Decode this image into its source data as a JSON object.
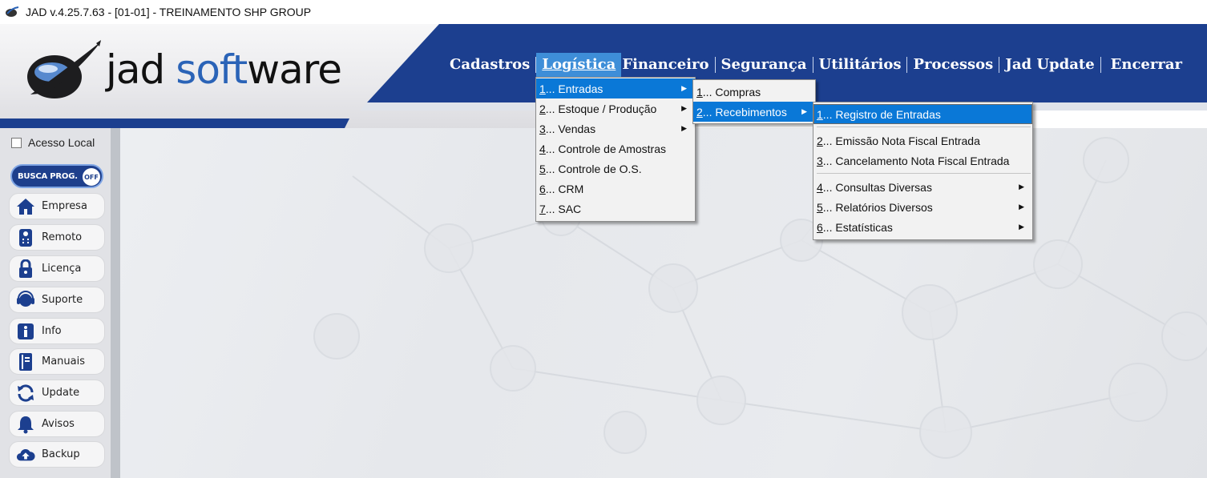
{
  "window": {
    "title": "JAD v.4.25.7.63 - [01-01] - TREINAMENTO SHP GROUP"
  },
  "brand": {
    "logo_word1": "jad",
    "logo_word2": "soft",
    "logo_word3": "ware",
    "accent_blue": "#1c3f8f",
    "highlight_blue": "#0a78d7"
  },
  "menubar": {
    "items": [
      {
        "label": "Cadastros"
      },
      {
        "label": "Logística",
        "active": true
      },
      {
        "label": "Financeiro"
      },
      {
        "label": "Segurança"
      },
      {
        "label": "Utilitários"
      },
      {
        "label": "Processos"
      },
      {
        "label": "Jad Update"
      },
      {
        "label": "Encerrar"
      }
    ]
  },
  "menu_logistica": {
    "items": [
      {
        "num": "1",
        "label": "... Entradas",
        "submenu": true
      },
      {
        "num": "2",
        "label": "... Estoque / Produção",
        "submenu": true
      },
      {
        "num": "3",
        "label": "... Vendas",
        "submenu": true
      },
      {
        "num": "4",
        "label": "... Controle de Amostras"
      },
      {
        "num": "5",
        "label": "... Controle de O.S."
      },
      {
        "num": "6",
        "label": "... CRM"
      },
      {
        "num": "7",
        "label": "... SAC"
      }
    ]
  },
  "menu_entradas": {
    "items": [
      {
        "num": "1",
        "label": "... Compras"
      },
      {
        "num": "2",
        "label": "... Recebimentos",
        "submenu": true
      }
    ]
  },
  "menu_recebimentos": {
    "items": [
      {
        "num": "1",
        "label": "... Registro de Entradas"
      },
      {
        "num": "2",
        "label": "... Emissão Nota Fiscal Entrada"
      },
      {
        "num": "3",
        "label": "... Cancelamento Nota Fiscal Entrada"
      },
      {
        "num": "4",
        "label": "... Consultas Diversas",
        "submenu": true
      },
      {
        "num": "5",
        "label": "... Relatórios Diversos",
        "submenu": true
      },
      {
        "num": "6",
        "label": "... Estatísticas",
        "submenu": true
      }
    ]
  },
  "sidebar": {
    "acesso_local_label": "Acesso Local",
    "acesso_local_checked": false,
    "busca_label": "BUSCA PROG.",
    "busca_state": "OFF",
    "buttons": [
      {
        "label": "Empresa",
        "icon": "home-icon"
      },
      {
        "label": "Remoto",
        "icon": "remote-control-icon"
      },
      {
        "label": "Licença",
        "icon": "lock-icon"
      },
      {
        "label": "Suporte",
        "icon": "headset-icon"
      },
      {
        "label": "Info",
        "icon": "info-icon"
      },
      {
        "label": "Manuais",
        "icon": "book-icon"
      },
      {
        "label": "Update",
        "icon": "refresh-icon"
      },
      {
        "label": "Avisos",
        "icon": "bell-icon"
      },
      {
        "label": "Backup",
        "icon": "cloud-upload-icon"
      }
    ]
  }
}
